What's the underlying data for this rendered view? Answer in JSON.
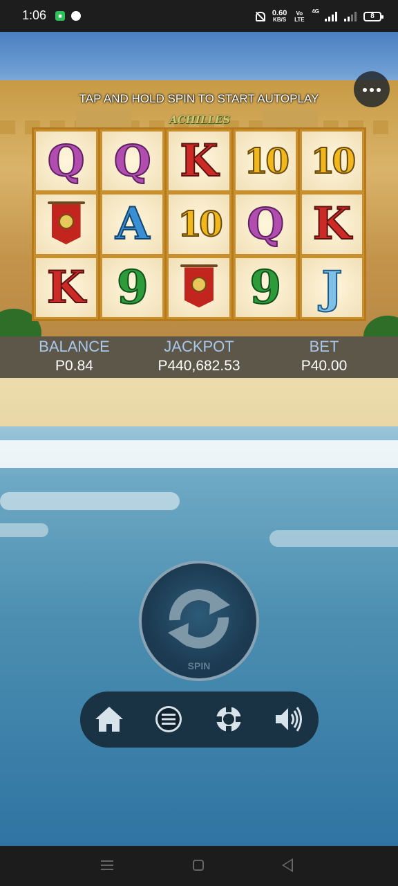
{
  "status_bar": {
    "time": "1:06",
    "speed_value": "0.60",
    "speed_unit": "KB/S",
    "volte": "Vo LTE",
    "network": "4G",
    "battery": "8"
  },
  "game": {
    "autoplay_hint": "TAP AND HOLD SPIN TO START AUTOPLAY",
    "logo": "ACHILLES",
    "reels": [
      [
        "Q",
        "banner",
        "K"
      ],
      [
        "Q",
        "A",
        "9"
      ],
      [
        "K",
        "10",
        "banner"
      ],
      [
        "10",
        "Q",
        "9"
      ],
      [
        "10",
        "K",
        "J"
      ]
    ],
    "info": {
      "balance_label": "BALANCE",
      "balance_value": "P0.84",
      "jackpot_label": "JACKPOT",
      "jackpot_value": "P440,682.53",
      "bet_label": "BET",
      "bet_value": "P40.00"
    },
    "spin_label": "SPIN"
  },
  "toolbar": {
    "icons": [
      "home-icon",
      "menu-icon",
      "help-icon",
      "sound-icon"
    ]
  },
  "nav": {
    "icons": [
      "recents-icon",
      "home-icon",
      "back-icon"
    ]
  }
}
